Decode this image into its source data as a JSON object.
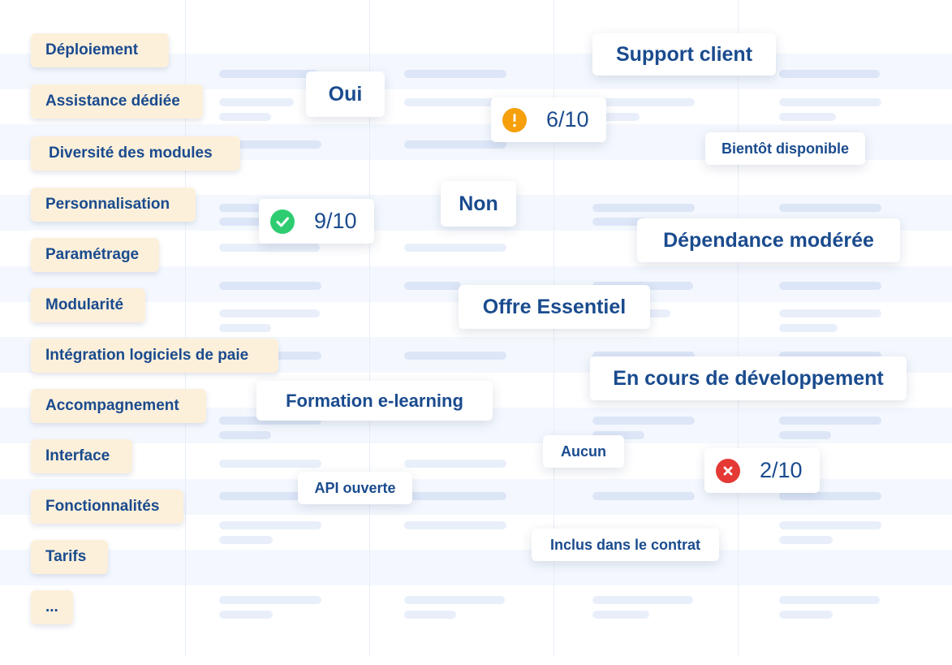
{
  "criteria": [
    "Déploiement",
    "Assistance dédiée",
    "Diversité des modules",
    "Personnalisation",
    "Paramétrage",
    "Modularité",
    "Intégration logiciels de paie",
    "Accompagnement",
    "Interface",
    "Fonctionnalités",
    "Tarifs",
    "..."
  ],
  "cards": {
    "support_client": "Support client",
    "oui": "Oui",
    "non": "Non",
    "bientot_disponible": "Bientôt disponible",
    "dependance_moderee": "Dépendance modérée",
    "offre_essentiel": "Offre Essentiel",
    "en_cours_developpement": "En cours de développement",
    "formation_elearning": "Formation e-learning",
    "aucun": "Aucun",
    "api_ouverte": "API ouverte",
    "inclus_contrat": "Inclus dans le contrat"
  },
  "scores": {
    "warning": "6/10",
    "success": "9/10",
    "error": "2/10"
  },
  "icons": {
    "warning": "warning-icon",
    "success": "check-icon",
    "error": "close-icon"
  },
  "colors": {
    "text": "#1a4b8e",
    "label_bg": "#fdf0db",
    "warning": "#f5a00c",
    "success": "#2ecc71",
    "error": "#e53935"
  }
}
